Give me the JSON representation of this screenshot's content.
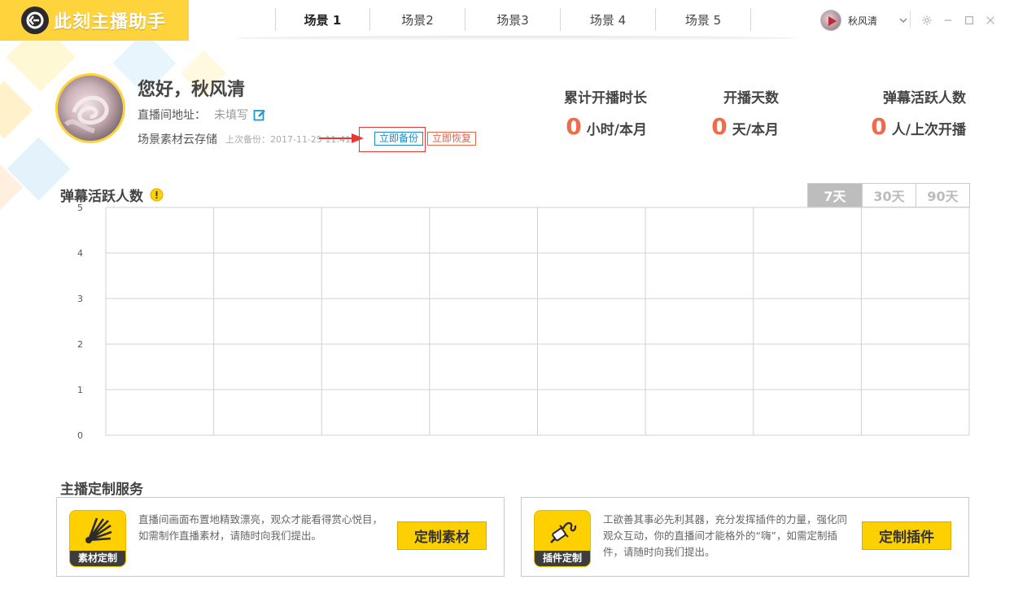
{
  "app": {
    "title": "此刻主播助手"
  },
  "tabs": [
    {
      "label": "场景 1",
      "active": true
    },
    {
      "label": "场景2",
      "active": false
    },
    {
      "label": "场景3",
      "active": false
    },
    {
      "label": "场景 4",
      "active": false
    },
    {
      "label": "场景 5",
      "active": false
    }
  ],
  "user": {
    "name": "秋风清"
  },
  "profile": {
    "greeting": "您好，秋风清",
    "address_label": "直播间地址：",
    "address_value": "未填写",
    "cloud_label": "场景素材云存储",
    "last_backup": "上次备份：2017-11-25 11:41",
    "backup_button": "立即备份",
    "restore_button": "立即恢复"
  },
  "stats": [
    {
      "label": "累计开播时长",
      "value": "0",
      "unit": "小时/本月"
    },
    {
      "label": "开播天数",
      "value": "0",
      "unit": "天/本月"
    },
    {
      "label": "弹幕活跃人数",
      "value": "0",
      "unit": "人/上次开播"
    }
  ],
  "chart_section": {
    "title": "弹幕活跃人数",
    "ranges": [
      {
        "label": "7天",
        "active": true
      },
      {
        "label": "30天",
        "active": false
      },
      {
        "label": "90天",
        "active": false
      }
    ]
  },
  "chart_data": {
    "type": "line",
    "title": "弹幕活跃人数",
    "x": [],
    "series": [],
    "ylim": [
      0,
      5
    ],
    "yticks": [
      "0",
      "1",
      "2",
      "3",
      "4",
      "5"
    ],
    "x_divisions": 8,
    "grid": true
  },
  "services": {
    "title": "主播定制服务",
    "cards": [
      {
        "icon": "sun-rays-icon",
        "icon_label": "素材定制",
        "desc": "直播间画面布置地精致漂亮，观众才能看得赏心悦目，如需制作直播素材，请随时向我们提出。",
        "button": "定制素材"
      },
      {
        "icon": "plug-icon",
        "icon_label": "插件定制",
        "desc": "工欲善其事必先利其器，充分发挥插件的力量，强化同观众互动，你的直播间才能格外的“嗨”，如需定制插件，请随时向我们提出。",
        "button": "定制插件"
      }
    ]
  },
  "colors": {
    "accent": "#ffd33c",
    "stat_number": "#f06a4c",
    "link_blue": "#1a88c9",
    "restore_red": "#e0664d"
  }
}
